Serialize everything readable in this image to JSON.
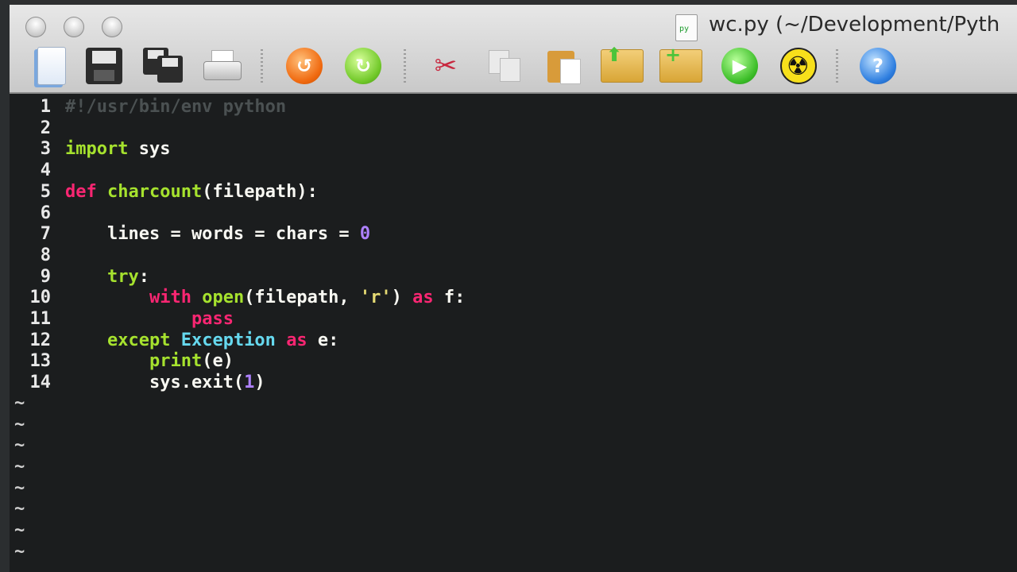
{
  "window": {
    "title": "wc.py (~/Development/Pyth",
    "doc_icon": "python-file-icon"
  },
  "toolbar": {
    "buttons": [
      {
        "name": "new-document-button",
        "icon": "new-document-icon"
      },
      {
        "name": "save-button",
        "icon": "floppy-disk-icon"
      },
      {
        "name": "save-all-button",
        "icon": "floppy-disks-icon"
      },
      {
        "name": "print-button",
        "icon": "printer-icon"
      },
      {
        "name": "undo-button",
        "icon": "undo-arrow-icon"
      },
      {
        "name": "redo-button",
        "icon": "redo-arrow-icon"
      },
      {
        "name": "cut-button",
        "icon": "scissors-icon"
      },
      {
        "name": "copy-button",
        "icon": "copy-icon"
      },
      {
        "name": "paste-button",
        "icon": "clipboard-icon"
      },
      {
        "name": "load-session-button",
        "icon": "folder-up-icon"
      },
      {
        "name": "new-session-button",
        "icon": "folder-plus-icon"
      },
      {
        "name": "run-button",
        "icon": "play-icon"
      },
      {
        "name": "make-button",
        "icon": "radiation-icon"
      },
      {
        "name": "help-button",
        "icon": "help-icon"
      }
    ]
  },
  "editor": {
    "line_numbers": [
      "1",
      "2",
      "3",
      "4",
      "5",
      "6",
      "7",
      "8",
      "9",
      "10",
      "11",
      "12",
      "13",
      "14"
    ],
    "lines": [
      [
        {
          "t": "#!/usr/bin/env python",
          "c": "cm"
        }
      ],
      [],
      [
        {
          "t": "import",
          "c": "im"
        },
        {
          "t": " sys",
          "c": "plain"
        }
      ],
      [],
      [
        {
          "t": "def",
          "c": "kw"
        },
        {
          "t": " ",
          "c": "plain"
        },
        {
          "t": "charcount",
          "c": "fn"
        },
        {
          "t": "(filepath):",
          "c": "plain"
        }
      ],
      [],
      [
        {
          "t": "    lines = words = chars = ",
          "c": "plain"
        },
        {
          "t": "0",
          "c": "num"
        }
      ],
      [],
      [
        {
          "t": "    ",
          "c": "plain"
        },
        {
          "t": "try",
          "c": "im"
        },
        {
          "t": ":",
          "c": "plain"
        }
      ],
      [
        {
          "t": "        ",
          "c": "plain"
        },
        {
          "t": "with",
          "c": "kw"
        },
        {
          "t": " ",
          "c": "plain"
        },
        {
          "t": "open",
          "c": "fn"
        },
        {
          "t": "(filepath, ",
          "c": "plain"
        },
        {
          "t": "'r'",
          "c": "str"
        },
        {
          "t": ") ",
          "c": "plain"
        },
        {
          "t": "as",
          "c": "kw"
        },
        {
          "t": " f:",
          "c": "plain"
        }
      ],
      [
        {
          "t": "            ",
          "c": "plain"
        },
        {
          "t": "pass",
          "c": "kw"
        }
      ],
      [
        {
          "t": "    ",
          "c": "plain"
        },
        {
          "t": "except",
          "c": "im"
        },
        {
          "t": " ",
          "c": "plain"
        },
        {
          "t": "Exception",
          "c": "cls"
        },
        {
          "t": " ",
          "c": "plain"
        },
        {
          "t": "as",
          "c": "kw"
        },
        {
          "t": " e:",
          "c": "plain"
        }
      ],
      [
        {
          "t": "        ",
          "c": "plain"
        },
        {
          "t": "print",
          "c": "fn"
        },
        {
          "t": "(e)",
          "c": "plain"
        }
      ],
      [
        {
          "t": "        sys.exit(",
          "c": "plain"
        },
        {
          "t": "1",
          "c": "num"
        },
        {
          "t": ")",
          "c": "plain"
        }
      ]
    ],
    "empty_line_marker": "~",
    "empty_line_count": 8
  },
  "colors": {
    "background": "#1b1d1e",
    "keyword": "#f92672",
    "function": "#a6e22e",
    "number": "#ae81ff",
    "string": "#e6db74",
    "class": "#66d9ef",
    "comment": "#4b5152"
  }
}
